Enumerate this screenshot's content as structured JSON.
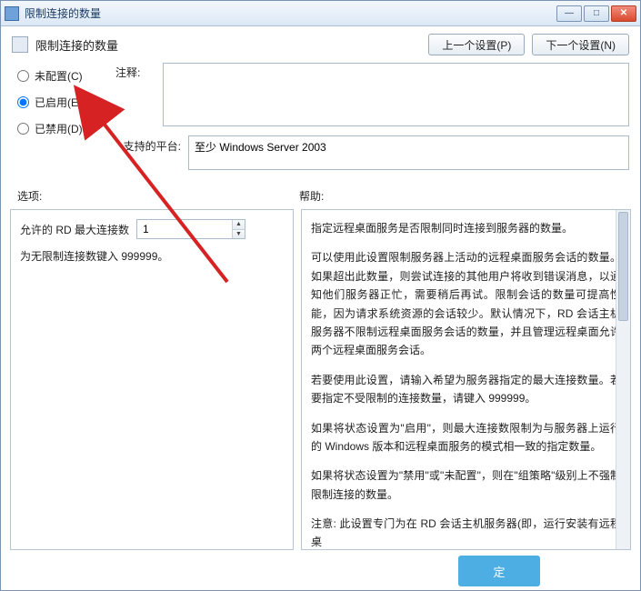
{
  "window": {
    "title": "限制连接的数量"
  },
  "header": {
    "title": "限制连接的数量",
    "prev_btn": "上一个设置(P)",
    "next_btn": "下一个设置(N)"
  },
  "radios": {
    "not_configured": "未配置(C)",
    "enabled": "已启用(E)",
    "disabled": "已禁用(D)",
    "selected": "enabled"
  },
  "comment": {
    "label": "注释:",
    "value": ""
  },
  "platform": {
    "label": "支持的平台:",
    "value": "至少 Windows Server 2003"
  },
  "sections": {
    "options_label": "选项:",
    "help_label": "帮助:"
  },
  "options": {
    "max_conn_label": "允许的 RD 最大连接数",
    "max_conn_value": "1",
    "unlimited_note": "为无限制连接数键入 999999。"
  },
  "help": {
    "p1": "指定远程桌面服务是否限制同时连接到服务器的数量。",
    "p2": "可以使用此设置限制服务器上活动的远程桌面服务会话的数量。如果超出此数量，则尝试连接的其他用户将收到错误消息，以通知他们服务器正忙，需要稍后再试。限制会话的数量可提高性能，因为请求系统资源的会话较少。默认情况下，RD 会话主机服务器不限制远程桌面服务会话的数量，并且管理远程桌面允许两个远程桌面服务会话。",
    "p3": "若要使用此设置，请输入希望为服务器指定的最大连接数量。若要指定不受限制的连接数量，请键入 999999。",
    "p4": "如果将状态设置为\"启用\"，则最大连接数限制为与服务器上运行的 Windows 版本和远程桌面服务的模式相一致的指定数量。",
    "p5": "如果将状态设置为\"禁用\"或\"未配置\"，则在\"组策略\"级别上不强制限制连接的数量。",
    "p6": "注意: 此设置专门为在 RD 会话主机服务器(即，运行安装有远程桌"
  },
  "footer": {
    "ok_text": "定"
  }
}
